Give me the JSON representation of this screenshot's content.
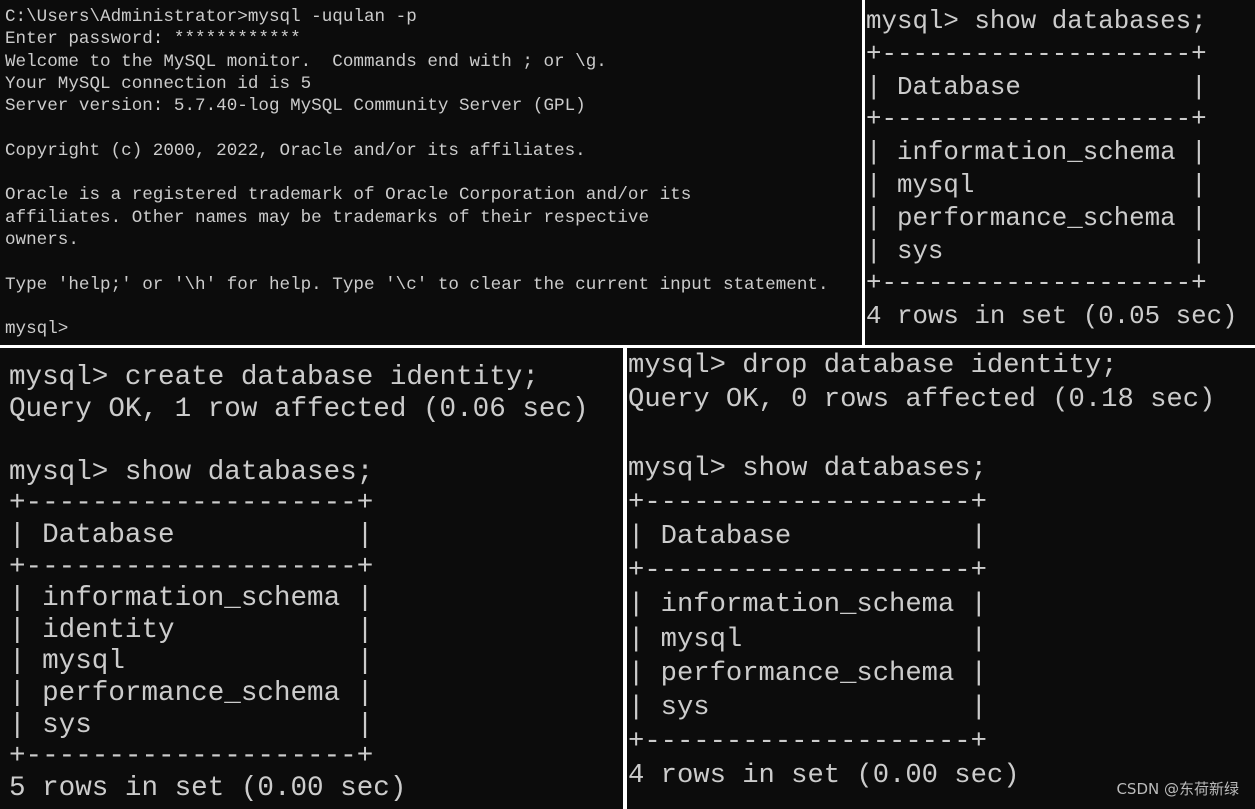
{
  "panels": {
    "login": {
      "lines": [
        "C:\\Users\\Administrator>mysql -uqulan -p",
        "Enter password: ************",
        "Welcome to the MySQL monitor.  Commands end with ; or \\g.",
        "Your MySQL connection id is 5",
        "Server version: 5.7.40-log MySQL Community Server (GPL)",
        "",
        "Copyright (c) 2000, 2022, Oracle and/or its affiliates.",
        "",
        "Oracle is a registered trademark of Oracle Corporation and/or its",
        "affiliates. Other names may be trademarks of their respective",
        "owners.",
        "",
        "Type 'help;' or '\\h' for help. Type '\\c' to clear the current input statement.",
        "",
        "mysql>"
      ]
    },
    "show_initial": {
      "lines": [
        "mysql> show databases;",
        "+--------------------+",
        "| Database           |",
        "+--------------------+",
        "| information_schema |",
        "| mysql              |",
        "| performance_schema |",
        "| sys                |",
        "+--------------------+",
        "4 rows in set (0.05 sec)"
      ]
    },
    "create": {
      "lines": [
        "mysql> create database identity;",
        "Query OK, 1 row affected (0.06 sec)",
        "",
        "mysql> show databases;",
        "+--------------------+",
        "| Database           |",
        "+--------------------+",
        "| information_schema |",
        "| identity           |",
        "| mysql              |",
        "| performance_schema |",
        "| sys                |",
        "+--------------------+",
        "5 rows in set (0.00 sec)"
      ]
    },
    "drop": {
      "lines": [
        "mysql> drop database identity;",
        "Query OK, 0 rows affected (0.18 sec)",
        "",
        "mysql> show databases;",
        "+--------------------+",
        "| Database           |",
        "+--------------------+",
        "| information_schema |",
        "| mysql              |",
        "| performance_schema |",
        "| sys                |",
        "+--------------------+",
        "4 rows in set (0.00 sec)"
      ]
    }
  },
  "watermark": "CSDN @东荷新绿",
  "colors": {
    "background": "#0c0c0c",
    "text": "#cccccc"
  }
}
